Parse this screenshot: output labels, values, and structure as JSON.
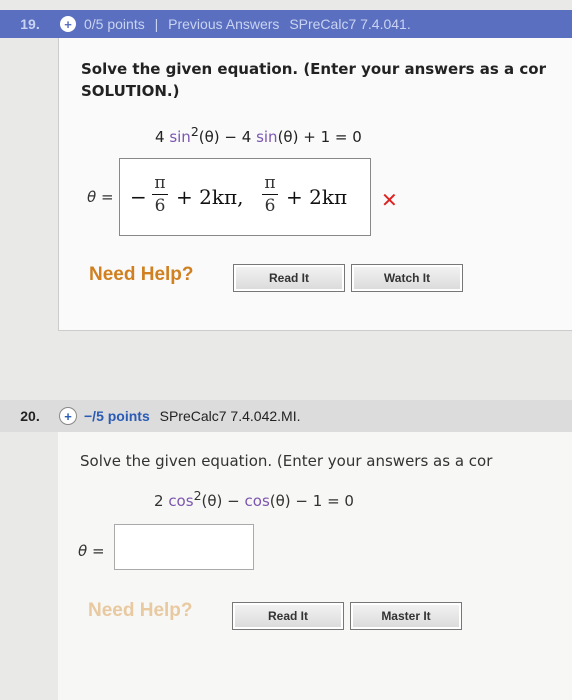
{
  "q19": {
    "number": "19.",
    "points": "0/5 points",
    "separator": "|",
    "previous": "Previous Answers",
    "source": "SPreCalc7 7.4.041.",
    "prompt_line1": "Solve the given equation. (Enter your answers as a cor",
    "prompt_line2": "SOLUTION.)",
    "equation": {
      "coef1": "4 ",
      "fn1": "sin",
      "sup1": "2",
      "arg1": "(θ)",
      "mid": " − 4 ",
      "fn2": "sin",
      "arg2": "(θ)",
      "end": " + 1 = 0"
    },
    "theta_label": "θ =",
    "answer": {
      "minus": "−",
      "pi1": "π",
      "den1": "6",
      "plus1": "+ 2kπ,",
      "pi2": "π",
      "den2": "6",
      "plus2": "+ 2kπ"
    },
    "status_icon": "x-mark-icon",
    "status_symbol": "✕",
    "need_help": "Need Help?",
    "read_it": "Read It",
    "watch_it": "Watch It"
  },
  "q20": {
    "number": "20.",
    "points": "−/5 points",
    "source": "SPreCalc7 7.4.042.MI.",
    "prompt": "Solve the given equation. (Enter your answers as a cor",
    "equation": {
      "coef1": "2 ",
      "fn1": "cos",
      "sup1": "2",
      "arg1": "(θ)",
      "mid": " − ",
      "fn2": "cos",
      "arg2": "(θ)",
      "end": " − 1 = 0"
    },
    "theta_label": "θ =",
    "answer_value": "",
    "need_help": "Need Help?",
    "read_it": "Read It",
    "master_it": "Master It"
  },
  "colors": {
    "header19": "#5a6fbf",
    "need_help": "#d08020",
    "wrong": "#d22222",
    "points_blue": "#2a5bb5"
  }
}
